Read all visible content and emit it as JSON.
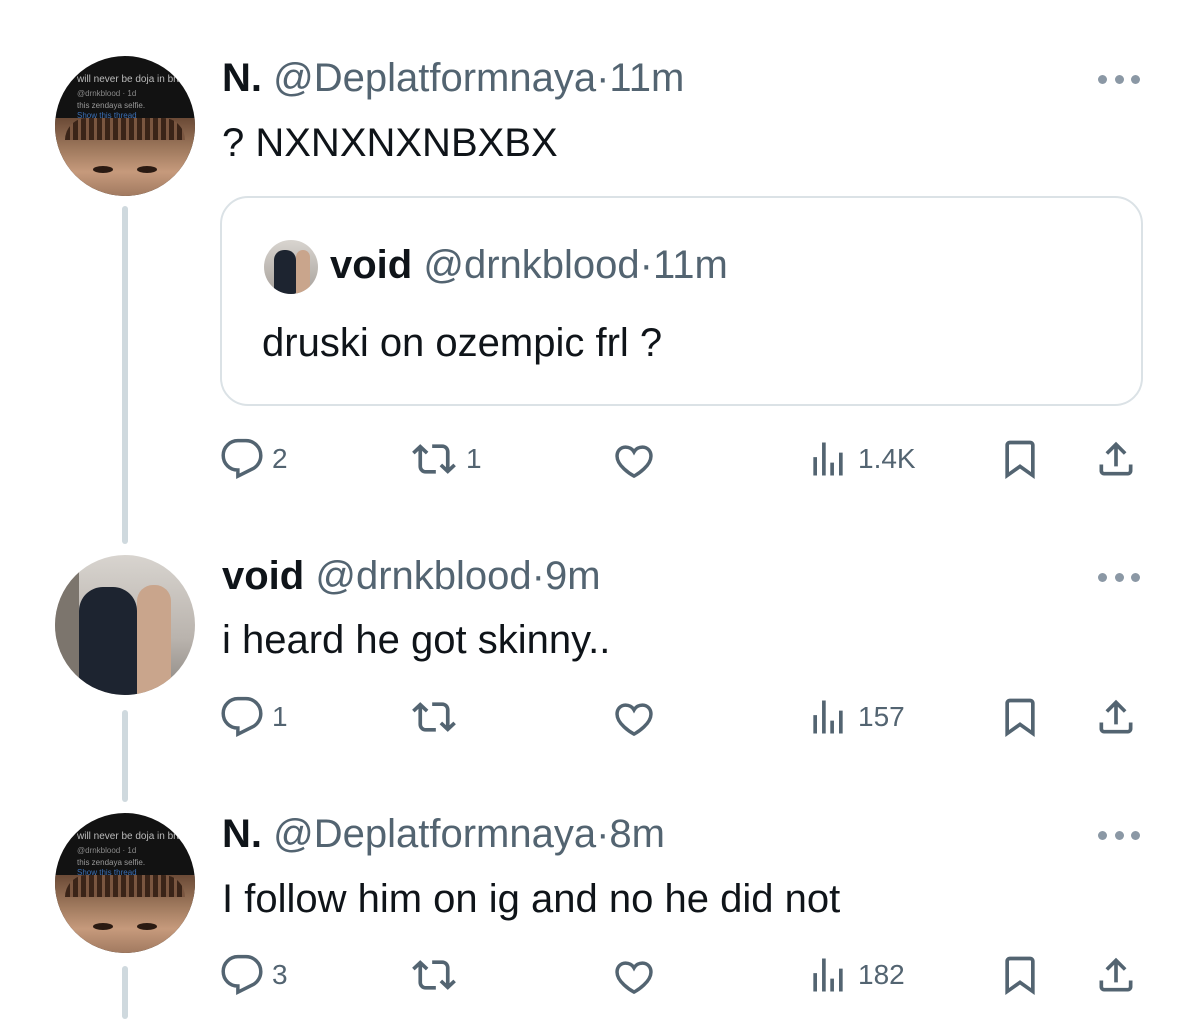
{
  "tweets": [
    {
      "name": "N.",
      "handle": "@Deplatformnaya",
      "dot": "·",
      "time": "11m",
      "text": "? NXNXNXNBXBX",
      "avatar_lines": [
        "will never be doja in braids",
        "@drnkblood · 1d",
        "this zendaya selfie.",
        "Show this thread"
      ],
      "quote": {
        "name": "void",
        "handle": "@drnkblood",
        "dot": "·",
        "time": "11m",
        "text": "druski on ozempic frl ?"
      },
      "stats": {
        "replies": "2",
        "reposts": "1",
        "likes": "",
        "views": "1.4K"
      }
    },
    {
      "name": "void",
      "handle": "@drnkblood",
      "dot": "·",
      "time": "9m",
      "text": "i heard he got skinny..",
      "stats": {
        "replies": "1",
        "reposts": "",
        "likes": "",
        "views": "157"
      }
    },
    {
      "name": "N.",
      "handle": "@Deplatformnaya",
      "dot": "·",
      "time": "8m",
      "text": "I follow him on ig and no he did not",
      "avatar_lines": [
        "will never be doja in braids",
        "@drnkblood · 1d",
        "this zendaya selfie.",
        "Show this thread"
      ],
      "stats": {
        "replies": "3",
        "reposts": "",
        "likes": "",
        "views": "182"
      }
    }
  ],
  "icons": {
    "reply": "speech-bubble-icon",
    "repost": "repost-arrows-icon",
    "like": "heart-icon",
    "views": "bar-chart-icon",
    "bookmark": "bookmark-icon",
    "share": "share-upload-icon",
    "more": "three-dots-icon"
  },
  "colors": {
    "text": "#0f1419",
    "secondary": "#536471",
    "thread_line": "#cfd9de",
    "border": "#dbe2e6"
  }
}
